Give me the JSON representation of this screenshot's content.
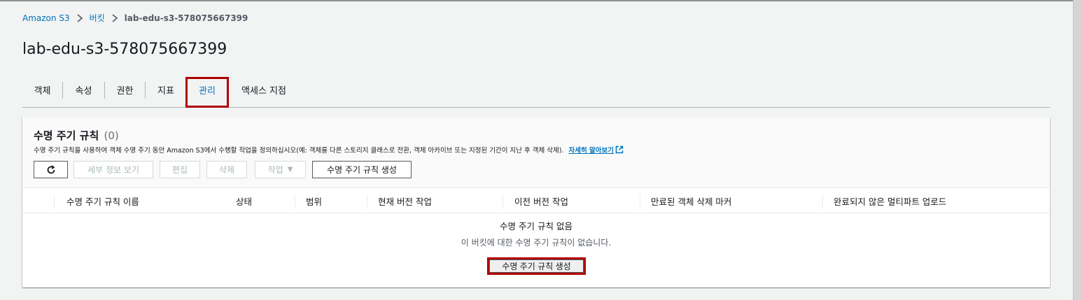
{
  "breadcrumb": {
    "items": [
      "Amazon S3",
      "버킷"
    ],
    "current": "lab-edu-s3-578075667399"
  },
  "page": {
    "title": "lab-edu-s3-578075667399"
  },
  "tabs": [
    {
      "label": "객체"
    },
    {
      "label": "속성"
    },
    {
      "label": "권한"
    },
    {
      "label": "지표"
    },
    {
      "label": "관리"
    },
    {
      "label": "액세스 지점"
    }
  ],
  "active_tab": "관리",
  "panel": {
    "title": "수명 주기 규칙",
    "count": "(0)",
    "description": "수명 주기 규칙을 사용하여 객체 수명 주기 동안 Amazon S3에서 수행할 작업을 정의하십시오(예: 객체를 다른 스토리지 클래스로 전환, 객체 아카이브 또는 지정된 기간이 지난 후 객체 삭제).",
    "learn_more": "자세히 알아보기",
    "actions": {
      "refresh_icon": "refresh-icon",
      "details": "세부 정보 보기",
      "edit": "편집",
      "delete": "삭제",
      "actions": "작업",
      "create": "수명 주기 규칙 생성"
    }
  },
  "table": {
    "columns": [
      "수명 주기 규칙 이름",
      "상태",
      "범위",
      "현재 버전 작업",
      "이전 버전 작업",
      "만료된 객체 삭제 마커",
      "완료되지 않은 멀티파트 업로드"
    ],
    "empty_title": "수명 주기 규칙 없음",
    "empty_desc": "이 버킷에 대한 수명 주기 규칙이 없습니다.",
    "empty_button": "수명 주기 규칙 생성"
  },
  "colors": {
    "link": "#0073bb",
    "highlight": "#b00000",
    "background": "#f2f3f3"
  }
}
